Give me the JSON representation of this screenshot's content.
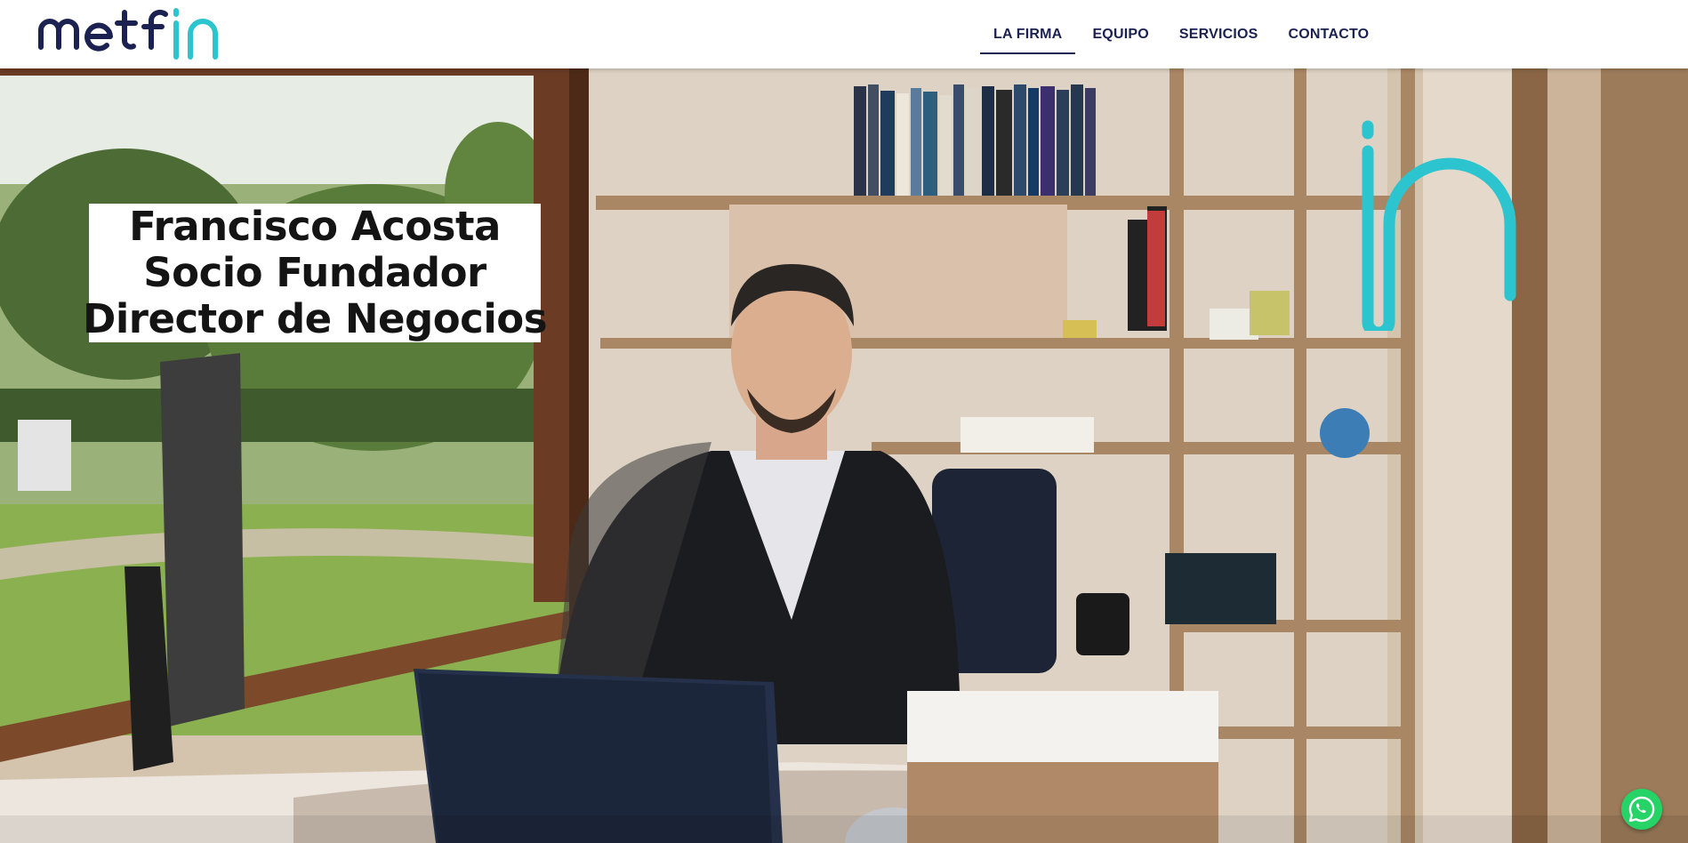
{
  "brand": {
    "logo_text": "metfin",
    "accent": "#2cc5cf",
    "dark": "#1b2150"
  },
  "nav": {
    "items": [
      {
        "label": "LA FIRMA",
        "active": true
      },
      {
        "label": "EQUIPO",
        "active": false
      },
      {
        "label": "SERVICIOS",
        "active": false
      },
      {
        "label": "CONTACTO",
        "active": false
      }
    ]
  },
  "hero": {
    "caption": {
      "line1": "Francisco Acosta",
      "line2": "Socio Fundador",
      "line3": "Director de Negocios"
    },
    "watermark_icon": "in-logo-mark"
  },
  "whatsapp": {
    "icon": "whatsapp-icon",
    "color": "#25d366"
  }
}
